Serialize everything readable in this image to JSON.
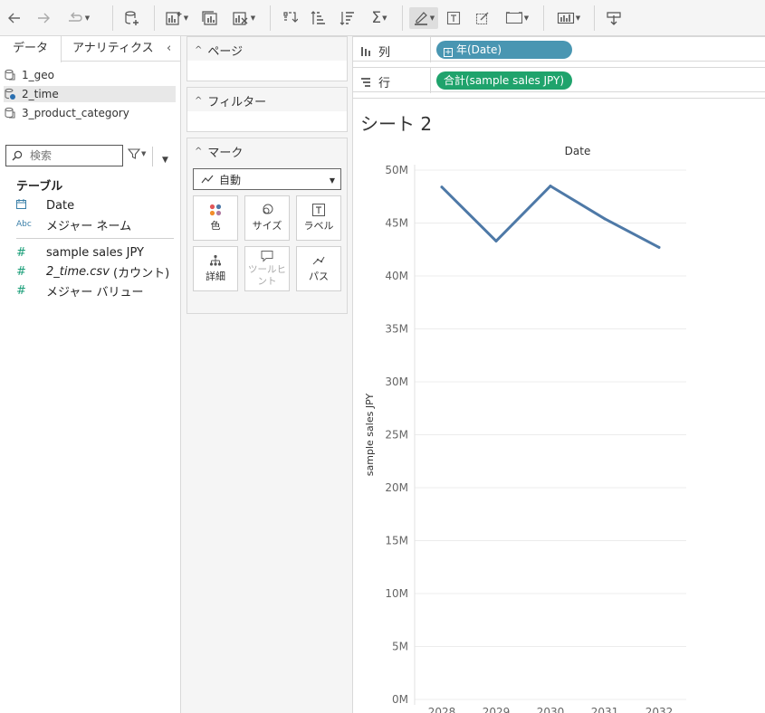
{
  "left_pane": {
    "tabs": {
      "data": "データ",
      "analytics": "アナリティクス"
    },
    "datasources": [
      "1_geo",
      "2_time",
      "3_product_category"
    ],
    "search_placeholder": "検索",
    "tables_heading": "テーブル",
    "dimensions": [
      {
        "icon": "calendar-icon",
        "label": "Date"
      },
      {
        "icon": "abc-icon",
        "label": "メジャー ネーム"
      }
    ],
    "measures": [
      {
        "icon": "number-icon",
        "label": "sample sales JPY"
      },
      {
        "icon": "number-icon",
        "label": "2_time.csv",
        "suffix": " (カウント)"
      },
      {
        "icon": "number-icon",
        "label": "メジャー バリュー"
      }
    ]
  },
  "cards": {
    "pages": "ページ",
    "filters": "フィルター",
    "marks": "マーク",
    "mark_type": "自動",
    "mark_buttons": [
      "色",
      "サイズ",
      "ラベル",
      "詳細",
      "ツールヒント",
      "パス"
    ]
  },
  "shelves": {
    "columns_label": "列",
    "rows_label": "行",
    "columns_pill": "年(Date)",
    "rows_pill": "合計(sample sales JPY)"
  },
  "sheet_title": "シート 2",
  "colors": {
    "line": "#4e79a7",
    "date_pill": "#4996b2",
    "measure_pill": "#1fa36c"
  },
  "chart_data": {
    "type": "line",
    "title": "Date",
    "xlabel": "",
    "ylabel": "sample sales JPY",
    "x": [
      "2028",
      "2029",
      "2030",
      "2031",
      "2032"
    ],
    "series": [
      {
        "values": [
          48400000,
          43300000,
          48500000,
          45400000,
          42700000
        ]
      }
    ],
    "ylim": [
      0,
      50000000
    ],
    "yticks": [
      "0M",
      "5M",
      "10M",
      "15M",
      "20M",
      "25M",
      "30M",
      "35M",
      "40M",
      "45M",
      "50M"
    ],
    "grid": true
  }
}
